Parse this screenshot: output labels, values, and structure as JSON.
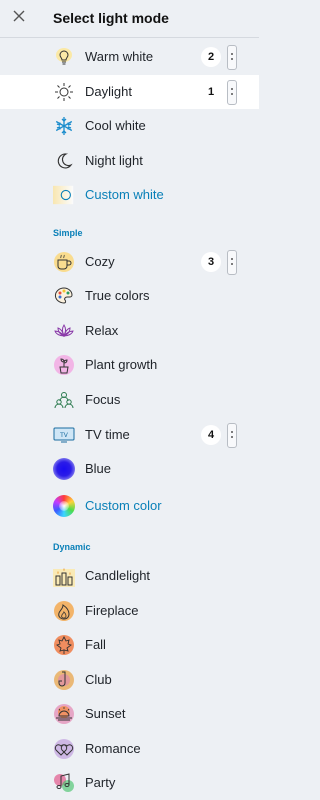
{
  "header": {
    "title": "Select light mode",
    "close_icon": "close-icon"
  },
  "white_modes": [
    {
      "label": "Warm white",
      "icon": "lightbulb-icon",
      "badge": "2"
    },
    {
      "label": "Daylight",
      "icon": "sun-icon",
      "badge": "1",
      "selected": true
    },
    {
      "label": "Cool white",
      "icon": "snowflake-icon"
    },
    {
      "label": "Night light",
      "icon": "moon-icon"
    },
    {
      "label": "Custom white",
      "icon": "custom-white-icon"
    }
  ],
  "simple": {
    "title": "Simple",
    "items": [
      {
        "label": "Cozy",
        "icon": "mug-icon",
        "badge": "3"
      },
      {
        "label": "True colors",
        "icon": "palette-icon"
      },
      {
        "label": "Relax",
        "icon": "lotus-icon"
      },
      {
        "label": "Plant growth",
        "icon": "plant-icon"
      },
      {
        "label": "Focus",
        "icon": "people-icon"
      },
      {
        "label": "TV time",
        "icon": "tv-icon",
        "badge": "4"
      },
      {
        "label": "Blue",
        "icon": "blue-dot-icon"
      },
      {
        "label": "Custom color",
        "icon": "color-wheel-icon"
      }
    ]
  },
  "dynamic": {
    "title": "Dynamic",
    "items": [
      {
        "label": "Candlelight",
        "icon": "candle-icon"
      },
      {
        "label": "Fireplace",
        "icon": "fire-icon"
      },
      {
        "label": "Fall",
        "icon": "leaf-icon"
      },
      {
        "label": "Club",
        "icon": "saxophone-icon"
      },
      {
        "label": "Sunset",
        "icon": "sunset-icon"
      },
      {
        "label": "Romance",
        "icon": "hearts-icon"
      },
      {
        "label": "Party",
        "icon": "music-notes-icon"
      }
    ]
  },
  "colors": {
    "accent": "#0a80b8",
    "background": "#edf0f4",
    "selected_row": "#ffffff"
  }
}
